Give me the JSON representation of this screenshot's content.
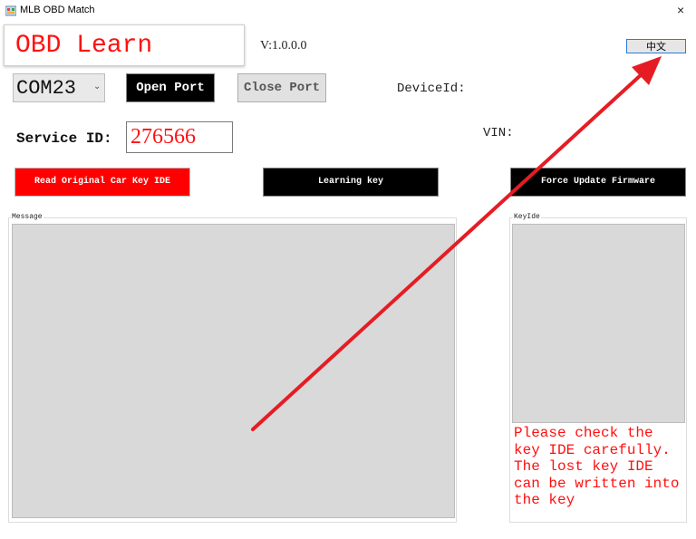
{
  "window": {
    "title": "MLB OBD Match",
    "close_glyph": "×",
    "icon": "app-icon"
  },
  "header": {
    "app_name": "OBD Learn",
    "version": "V:1.0.0.0",
    "language_button": "中文"
  },
  "port": {
    "selected": "COM23",
    "open_label": "Open Port",
    "close_label": "Close Port",
    "device_label": "DeviceId:"
  },
  "service": {
    "label": "Service ID:",
    "value": "276566",
    "vin_label": "VIN:"
  },
  "actions": {
    "read_label": "Read Original Car Key IDE",
    "learn_label": "Learning key",
    "firmware_label": "Force Update Firmware"
  },
  "panels": {
    "message_label": "Message",
    "keyide_label": "KeyIde"
  },
  "annotation": {
    "note": "Please check the\nkey IDE carefully.\nThe lost key IDE\ncan be written into\nthe key",
    "arrow_color": "#e61c24"
  },
  "colors": {
    "accent_red": "#ff1010",
    "button_black": "#000000",
    "button_red": "#ff0000",
    "panel_gray": "#d9d9d9"
  }
}
